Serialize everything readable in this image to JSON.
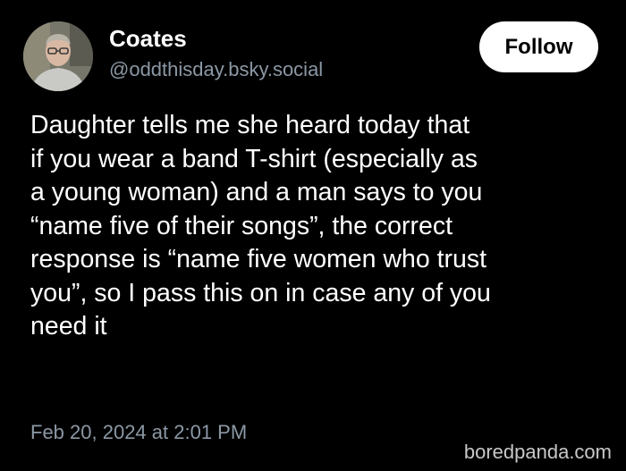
{
  "author": {
    "display_name": "Coates",
    "handle": "@oddthisday.bsky.social",
    "avatar_icon": "user-avatar-photo"
  },
  "follow_button": {
    "label": "Follow"
  },
  "post": {
    "lines": [
      "Daughter tells me she heard today that",
      "if you wear a band T-shirt (especially as",
      "a young woman) and a man says to you",
      "“name five of their songs”, the correct",
      "response is “name five women who trust",
      "you”, so I pass this on in case any of you",
      "need it"
    ],
    "timestamp": "Feb 20, 2024 at 2:01 PM"
  },
  "watermark": {
    "text": "boredpanda.com"
  },
  "colors": {
    "background": "#000000",
    "text": "#ffffff",
    "muted": "#8b98a5",
    "button_bg": "#ffffff",
    "button_text": "#000000"
  }
}
